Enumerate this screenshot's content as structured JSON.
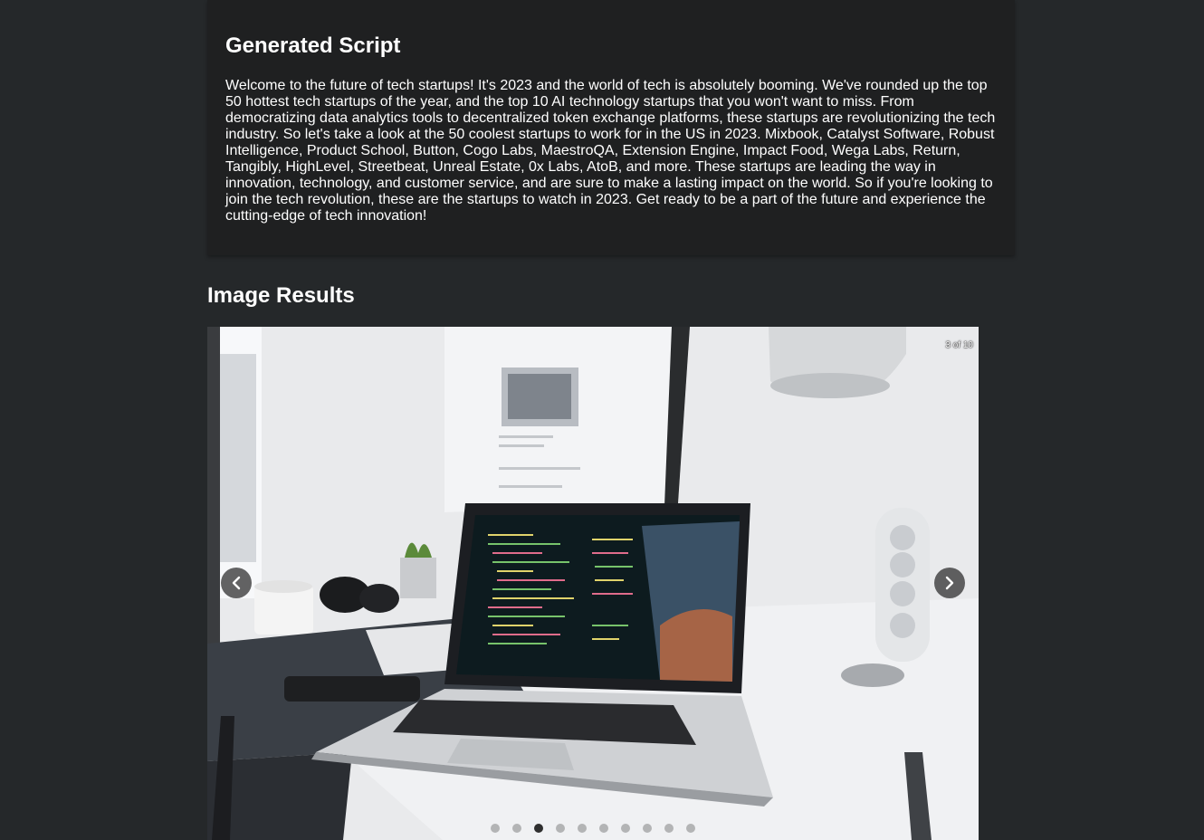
{
  "script_section": {
    "title": "Generated Script",
    "body": "Welcome to the future of tech startups! It's 2023 and the world of tech is absolutely booming. We've rounded up the top 50 hottest tech startups of the year, and the top 10 AI technology startups that you won't want to miss. From democratizing data analytics tools to decentralized token exchange platforms, these startups are revolutionizing the tech industry. So let's take a look at the 50 coolest startups to work for in the US in 2023. Mixbook, Catalyst Software, Robust Intelligence, Product School, Button, Cogo Labs, MaestroQA, Extension Engine, Impact Food, Wega Labs, Return, Tangibly, HighLevel, Streetbeat, Unreal Estate, 0x Labs, AtoB, and more. These startups are leading the way in innovation, technology, and customer service, and are sure to make a lasting impact on the world. So if you're looking to join the tech revolution, these are the startups to watch in 2023. Get ready to be a part of the future and experience the cutting-edge of tech innovation!"
  },
  "image_results": {
    "title": "Image Results",
    "counter": "3 of 10",
    "current_index": 3,
    "total": 10,
    "prev_icon": "chevron-left-icon",
    "next_icon": "chevron-right-icon"
  },
  "colors": {
    "page_background": "#25282a",
    "card_background": "#1f2021",
    "text": "#ffffff",
    "dot_active": "#191919",
    "dot_inactive": "#828282"
  }
}
